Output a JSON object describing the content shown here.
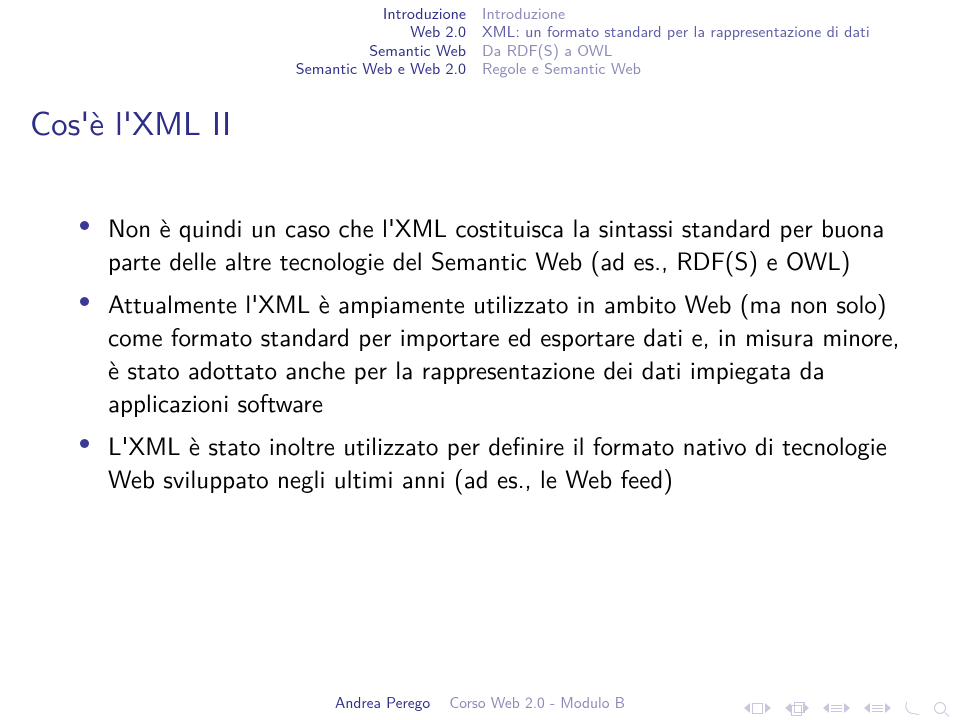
{
  "header": {
    "sections": [
      "Introduzione",
      "Web 2.0",
      "Semantic Web",
      "Semantic Web e Web 2.0"
    ],
    "subsections": [
      "Introduzione",
      "XML: un formato standard per la rappresentazione di dati",
      "Da RDF(S) a OWL",
      "Regole e Semantic Web"
    ],
    "activeSection": 0,
    "activeSubsection": 1
  },
  "frametitle": "Cos'è l'XML II",
  "bullets": [
    "Non è quindi un caso che l'XML costituisca la sintassi standard per buona parte delle altre tecnologie del Semantic Web (ad es., RDF(S) e OWL)",
    "Attualmente l'XML è ampiamente utilizzato in ambito Web (ma non solo) come formato standard per importare ed esportare dati e, in misura minore, è stato adottato anche per la rappresentazione dei dati impiegata da applicazioni software",
    "L'XML è stato inoltre utilizzato per definire il formato nativo di tecnologie Web sviluppato negli ultimi anni (ad es., le Web feed)"
  ],
  "footer": {
    "author": "Andrea Perego",
    "title": "Corso Web 2.0 - Modulo B"
  }
}
